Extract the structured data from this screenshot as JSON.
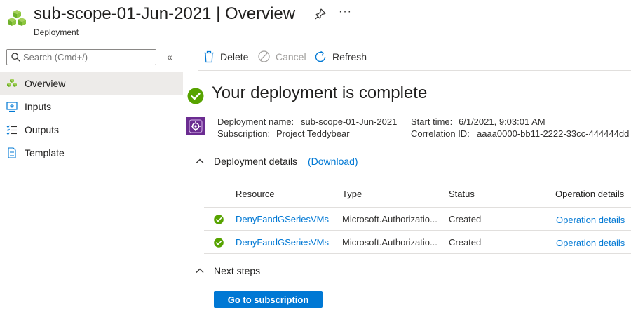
{
  "header": {
    "title": "sub-scope-01-Jun-2021 | Overview",
    "subtitle": "Deployment",
    "more_label": "···"
  },
  "sidebar": {
    "search_placeholder": "Search (Cmd+/)",
    "collapse_label": "«",
    "items": [
      {
        "label": "Overview",
        "icon": "deployment-icon",
        "active": true
      },
      {
        "label": "Inputs",
        "icon": "inputs-icon",
        "active": false
      },
      {
        "label": "Outputs",
        "icon": "outputs-icon",
        "active": false
      },
      {
        "label": "Template",
        "icon": "template-icon",
        "active": false
      }
    ]
  },
  "toolbar": {
    "delete_label": "Delete",
    "cancel_label": "Cancel",
    "refresh_label": "Refresh"
  },
  "main": {
    "status_title": "Your deployment is complete",
    "deployment_name_label": "Deployment name:",
    "deployment_name_value": "sub-scope-01-Jun-2021",
    "subscription_label": "Subscription:",
    "subscription_value": "Project Teddybear",
    "start_time_label": "Start time:",
    "start_time_value": "6/1/2021, 9:03:01 AM",
    "correlation_label": "Correlation ID:",
    "correlation_value": "aaaa0000-bb11-2222-33cc-444444dd",
    "details_header": "Deployment details",
    "download_label": "(Download)",
    "columns": [
      "Resource",
      "Type",
      "Status",
      "Operation details"
    ],
    "rows": [
      {
        "resource": "DenyFandGSeriesVMs",
        "type": "Microsoft.Authorizatio...",
        "status": "Created",
        "operation": "Operation details"
      },
      {
        "resource": "DenyFandGSeriesVMs",
        "type": "Microsoft.Authorizatio...",
        "status": "Created",
        "operation": "Operation details"
      }
    ],
    "next_steps_header": "Next steps",
    "goto_button": "Go to subscription"
  },
  "colors": {
    "accent": "#0078d4",
    "success": "#57a300",
    "nav_active_bg": "#edebe9",
    "deployment_icon": "#6b2c91"
  }
}
